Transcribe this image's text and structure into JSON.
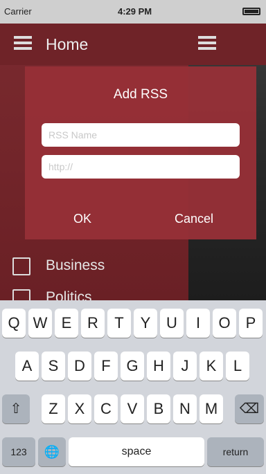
{
  "status": {
    "carrier": "Carrier",
    "time": "4:29 PM"
  },
  "menu": {
    "home": "Home",
    "items": [
      {
        "label": "Business"
      },
      {
        "label": "Politics"
      }
    ]
  },
  "dialog": {
    "title": "Add RSS",
    "name_placeholder": "RSS Name",
    "url_placeholder": "http://",
    "ok": "OK",
    "cancel": "Cancel"
  },
  "keyboard": {
    "row1": [
      "Q",
      "W",
      "E",
      "R",
      "T",
      "Y",
      "U",
      "I",
      "O",
      "P"
    ],
    "row2": [
      "A",
      "S",
      "D",
      "F",
      "G",
      "H",
      "J",
      "K",
      "L"
    ],
    "row3": [
      "Z",
      "X",
      "C",
      "V",
      "B",
      "N",
      "M"
    ],
    "shift": "⇧",
    "delete": "⌫",
    "num": "123",
    "globe": "🌐",
    "space": "space",
    "return": "return"
  }
}
